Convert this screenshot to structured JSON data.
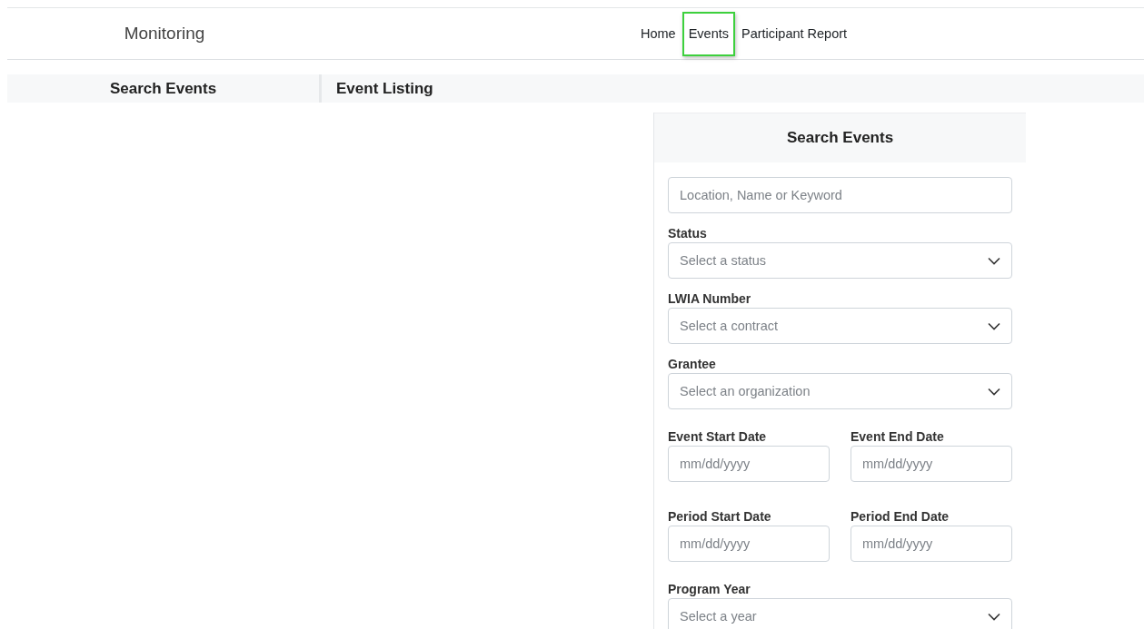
{
  "nav": {
    "brand": "Monitoring",
    "links": [
      {
        "label": "Home",
        "selected": false
      },
      {
        "label": "Events",
        "selected": true
      },
      {
        "label": "Participant Report",
        "selected": false
      }
    ]
  },
  "background_headers": [
    "Search Events",
    "Event Listing"
  ],
  "search_panel": {
    "title": "Search Events",
    "keyword": {
      "placeholder": "Location, Name or Keyword"
    },
    "fields": [
      {
        "kind": "select",
        "label": "Status",
        "placeholder": "Select a status"
      },
      {
        "kind": "select",
        "label": "LWIA Number",
        "placeholder": "Select a contract"
      },
      {
        "kind": "select",
        "label": "Grantee",
        "placeholder": "Select an organization"
      },
      {
        "kind": "dates",
        "items": [
          {
            "label": "Event Start Date",
            "placeholder": "mm/dd/yyyy"
          },
          {
            "label": "Event End Date",
            "placeholder": "mm/dd/yyyy"
          }
        ]
      },
      {
        "kind": "dates",
        "items": [
          {
            "label": "Period Start Date",
            "placeholder": "mm/dd/yyyy"
          },
          {
            "label": "Period End Date",
            "placeholder": "mm/dd/yyyy"
          }
        ]
      },
      {
        "kind": "select",
        "label": "Program Year",
        "placeholder": "Select a year"
      }
    ]
  }
}
